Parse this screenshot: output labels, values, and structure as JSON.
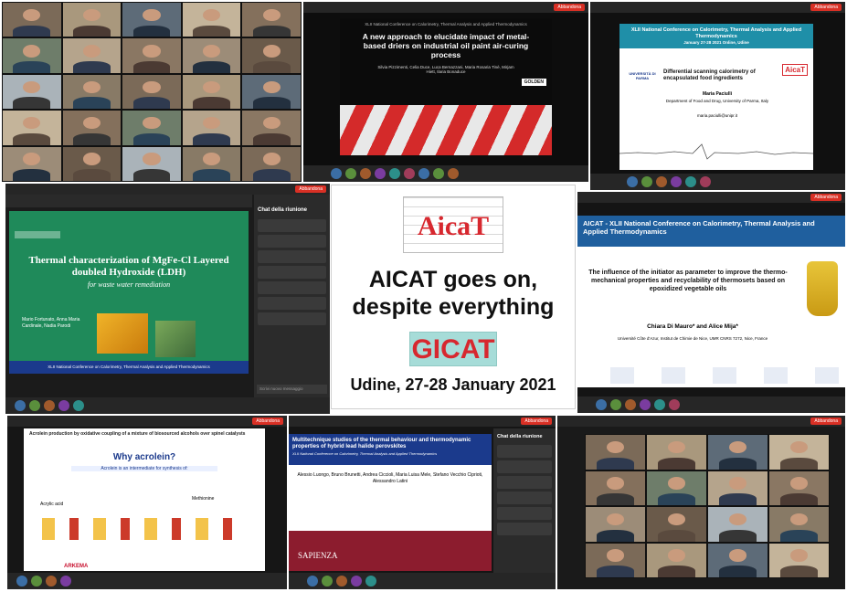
{
  "center": {
    "logo_top": "AicaT",
    "headline_line1": "AICAT goes on,",
    "headline_line2": "despite everything",
    "logo_bottom": "GICAT",
    "date_place": "Udine, 27-28 January 2021"
  },
  "panels": {
    "p2": {
      "title": "A new approach to elucidate impact of metal-based driers on industrial oil paint air-curing process",
      "conference": "XLII National Conference on Calorimetry, Thermal Analysis and Applied Thermodynamics",
      "authors": "Silvia Pizzimenti, Celia Duce, Luca Bernazzani, Maria Rosaria Tinè, Mirjam Hiett, Ilaria Bonaduce",
      "logo": "GOLDEN"
    },
    "p3": {
      "conference": "XLII National Conference on Calorimetry, Thermal Analysis and Applied Thermodynamics",
      "dates": "January 27-28 2021 Online, Udine",
      "title": "Differential scanning calorimetry of encapsulated food ingredients",
      "author": "Maria Paciulli",
      "affiliation": "Department of Food and Drug, University of Parma, Italy",
      "email": "maria.paciulli@unipr.it",
      "university": "UNIVERSITÀ DI PARMA",
      "logo": "AicaT"
    },
    "p4": {
      "title": "Thermal characterization of MgFe-Cl Layered doubled Hydroxide (LDH)",
      "subtitle": "for waste water remediation",
      "authors": "Mario Fortunato, Anna Maria Cardinale, Nadia Parodi",
      "footer": "XLII National Conference on Calorimetry, Thermal Analysis and Applied Thermodynamics",
      "chat_title": "Chat della riunione",
      "chat_input": "Scrivi nuovo messaggio"
    },
    "p6": {
      "header": "AICAT - XLII National Conference on Calorimetry, Thermal Analysis and Applied Thermodynamics",
      "title": "The influence of the initiator as parameter to improve the thermo-mechanical properties and recyclability of thermosets based on epoxidized vegetable oils",
      "authors": "Chiara Di Mauro* and Alice Mija*",
      "affiliation": "Université Côte d'Azur, Institut de Chimie de Nice, UMR CNRS 7272, Nice, France"
    },
    "p7": {
      "title": "Acrolein production by oxidative coupling of a mixture of biosourced alcohols over spinel catalysts",
      "question": "Why acrolein?",
      "subtitle": "Acrolein is an intermediate for synthesis of:",
      "item1": "Acrylic acid",
      "item2": "Methionine",
      "logo": "ARKEMA"
    },
    "p8": {
      "title": "Multitechnique studies of the thermal behaviour and thermodynamic properties of hybrid lead halide perovskites",
      "subtitle": "XLII National Conference on Calorimetry, Thermal Analysis and Applied Thermodynamics",
      "authors": "Alessio Luongo, Bruno Brunetti, Andrea Ciccioli, Maria Luisa Mele, Stefano Vecchio Ciprioti, Alessandro Latini",
      "university": "SAPIENZA",
      "chat_title": "Chat della riunione"
    }
  },
  "colors": {
    "aicat_red": "#d7282f",
    "gicat_teal": "#a6dcd8",
    "leave_red": "#d93025",
    "slide_green": "#1f8a5a",
    "slide_blue": "#1b3a8c"
  }
}
